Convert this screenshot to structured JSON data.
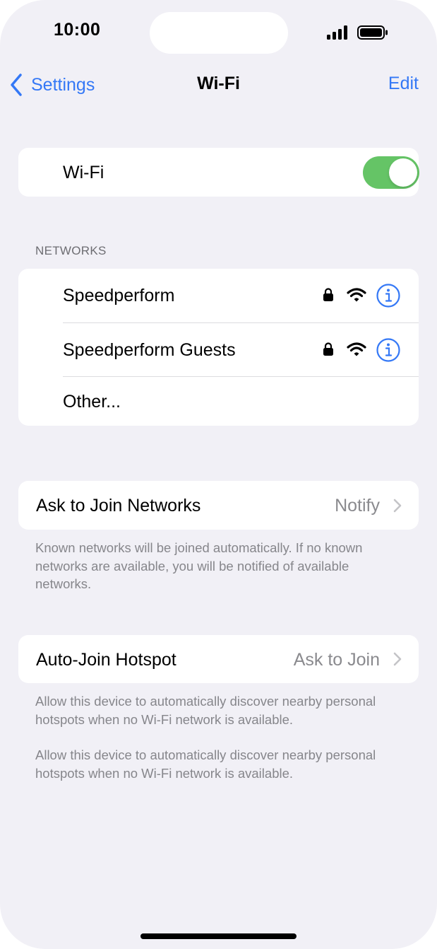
{
  "status_bar": {
    "time": "10:00",
    "icons": [
      "signal-icon",
      "battery-icon"
    ]
  },
  "nav": {
    "back_label": "Settings",
    "title": "Wi-Fi",
    "edit_label": "Edit"
  },
  "wifi_toggle": {
    "label": "Wi-Fi",
    "on": true
  },
  "networks": {
    "header": "NETWORKS",
    "items": [
      {
        "name": "Speedperform",
        "secured": true
      },
      {
        "name": "Speedperform Guests",
        "secured": true
      },
      {
        "name": "Other..."
      }
    ]
  },
  "ask_to_join": {
    "label": "Ask to Join Networks",
    "value": "Notify",
    "footnote": "Known networks will be joined automatically. If no known networks are available, you will be notified of available networks."
  },
  "auto_join": {
    "label": "Auto-Join Hotspot",
    "value": "Ask to Join",
    "footnote_1": "Allow this device to automatically discover nearby personal hotspots when no Wi-Fi network is available.",
    "footnote_2": "Allow this device to automatically discover nearby personal hotspots when no Wi-Fi network is available."
  },
  "colors": {
    "accent": "#3478f6",
    "toggle_on": "#65c466",
    "background": "#f1f0f6"
  }
}
